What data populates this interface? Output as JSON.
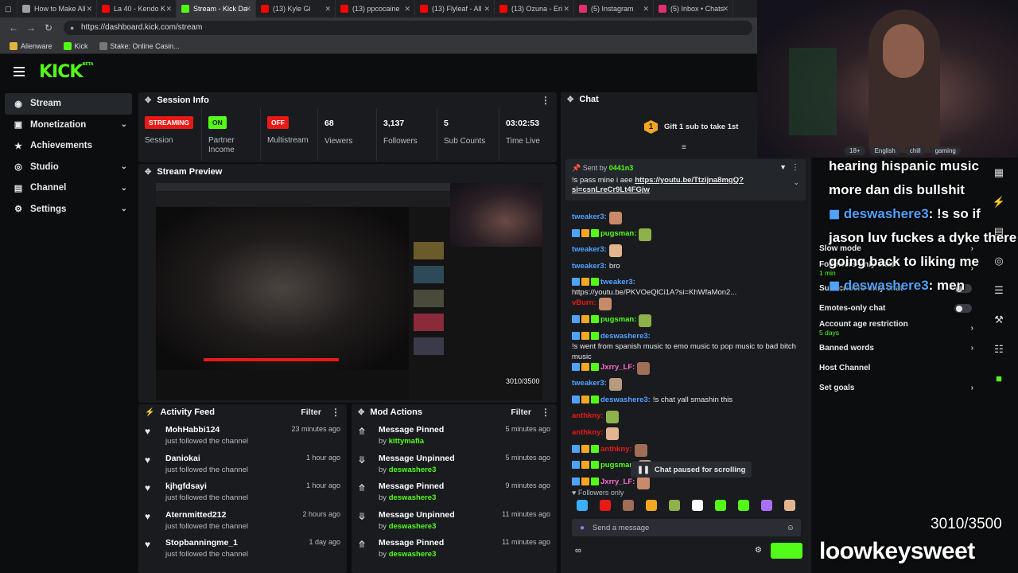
{
  "browser": {
    "tabs": [
      {
        "label": "How to Make All",
        "color": "#9aa0a6"
      },
      {
        "label": "La 40 - Kendo K",
        "color": "#ff0000"
      },
      {
        "label": "Stream - Kick Da",
        "color": "#53fc18",
        "active": true
      },
      {
        "label": "(13) Kyle Gi",
        "color": "#ff0000"
      },
      {
        "label": "(13) ppcocaine",
        "color": "#ff0000"
      },
      {
        "label": "(13) Flyleaf - All",
        "color": "#ff0000"
      },
      {
        "label": "(13) Ozuna - Eri",
        "color": "#ff0000"
      },
      {
        "label": "(5) Instagram",
        "color": "#e1306c"
      },
      {
        "label": "(5) Inbox • Chats",
        "color": "#e1306c"
      }
    ],
    "url": "https://dashboard.kick.com/stream",
    "bookmarks": [
      "Alienware",
      "Kick",
      "Stake: Online Casin..."
    ]
  },
  "header": {
    "logo": "KICK",
    "logo_sup": "BETA"
  },
  "sidebar": {
    "items": [
      {
        "label": "Stream",
        "icon": "broadcast-icon"
      },
      {
        "label": "Monetization",
        "icon": "money-icon"
      },
      {
        "label": "Achievements",
        "icon": "trophy-icon"
      },
      {
        "label": "Studio",
        "icon": "studio-icon"
      },
      {
        "label": "Channel",
        "icon": "channel-icon"
      },
      {
        "label": "Settings",
        "icon": "gear-icon"
      }
    ]
  },
  "session": {
    "title": "Session Info",
    "stats": [
      {
        "badge": "STREAMING",
        "badge_color": "#e91916",
        "label": "Session"
      },
      {
        "badge": "ON",
        "badge_color": "#53fc18",
        "label": "Partner Income"
      },
      {
        "badge": "OFF",
        "badge_color": "#e91916",
        "label": "Multistream"
      },
      {
        "value": "68",
        "label": "Viewers"
      },
      {
        "value": "3,137",
        "label": "Followers"
      },
      {
        "value": "5",
        "label": "Sub Counts"
      },
      {
        "value": "03:02:53",
        "label": "Time Live"
      }
    ]
  },
  "preview": {
    "title": "Stream Preview",
    "counter": "3010/3500"
  },
  "activity": {
    "title": "Activity Feed",
    "filter": "Filter",
    "items": [
      {
        "name": "MohHabbi124",
        "sub": "just followed the channel",
        "time": "23 minutes ago"
      },
      {
        "name": "Daniokai",
        "sub": "just followed the channel",
        "time": "1 hour ago"
      },
      {
        "name": "kjhgfdsayi",
        "sub": "just followed the channel",
        "time": "1 hour ago"
      },
      {
        "name": "Aternmitted212",
        "sub": "just followed the channel",
        "time": "2 hours ago"
      },
      {
        "name": "Stopbanningme_1",
        "sub": "just followed the channel",
        "time": "1 day ago"
      }
    ]
  },
  "modactions": {
    "title": "Mod Actions",
    "filter": "Filter",
    "items": [
      {
        "name": "Message Pinned",
        "by": "by",
        "user": "kittymafia",
        "time": "5 minutes ago",
        "icon": "pin-icon"
      },
      {
        "name": "Message Unpinned",
        "by": "by",
        "user": "deswashere3",
        "time": "5 minutes ago",
        "icon": "unpin-icon"
      },
      {
        "name": "Message Pinned",
        "by": "by",
        "user": "deswashere3",
        "time": "9 minutes ago",
        "icon": "pin-icon"
      },
      {
        "name": "Message Unpinned",
        "by": "by",
        "user": "deswashere3",
        "time": "11 minutes ago",
        "icon": "unpin-icon"
      },
      {
        "name": "Message Pinned",
        "by": "by",
        "user": "deswashere3",
        "time": "11 minutes ago",
        "icon": "pin-icon"
      }
    ]
  },
  "chat": {
    "title": "Chat",
    "gift_count": "1",
    "gift_text": "Gift 1 sub to take 1st",
    "pinned": {
      "sent_by_label": "Sent by",
      "sent_by_user": "0441n3",
      "text": "!s pass mine i aee",
      "link": "https://youtu.be/Ttzijna8mgQ?si=csnLreCr9Lt4FGjw"
    },
    "messages": [
      {
        "user": "tweaker3:",
        "color": "#4fa3ff",
        "text": ""
      },
      {
        "user": "pugsman:",
        "color": "#53fc18",
        "text": ""
      },
      {
        "user": "tweaker3:",
        "color": "#4fa3ff",
        "text": ""
      },
      {
        "user": "tweaker3:",
        "color": "#4fa3ff",
        "text": "bro"
      },
      {
        "user": "tweaker3:",
        "color": "#4fa3ff",
        "text": "https://youtu.be/PKVOeQlCi1A?si=KhWfaMon2..."
      },
      {
        "user": "vBurn:",
        "color": "#e91916",
        "text": ""
      },
      {
        "user": "pugsman:",
        "color": "#53fc18",
        "text": ""
      },
      {
        "user": "deswashere3:",
        "color": "#4fa3ff",
        "text": "!s went from spanish music to emo music to pop music to bad bitch music"
      },
      {
        "user": "Jxrry_LF:",
        "color": "#ff6bcb",
        "text": ""
      },
      {
        "user": "tweaker3:",
        "color": "#4fa3ff",
        "text": ""
      },
      {
        "user": "deswashere3:",
        "color": "#4fa3ff",
        "text": "!s chat yall smashin this"
      },
      {
        "user": "anthkny:",
        "color": "#e91916",
        "text": ""
      },
      {
        "user": "anthkny:",
        "color": "#e91916",
        "text": ""
      },
      {
        "user": "anthkny:",
        "color": "#e91916",
        "text": ""
      },
      {
        "user": "pugsman:",
        "color": "#53fc18",
        "text": ""
      },
      {
        "user": "Jxrry_LF:",
        "color": "#ff6bcb",
        "text": ""
      }
    ],
    "paused": "Chat paused for scrolling",
    "followers_only": "Followers only",
    "placeholder": "Send a message"
  },
  "chat_settings": {
    "items": [
      {
        "label": "Slow mode",
        "type": "arrow"
      },
      {
        "label": "Followers-only chat",
        "sub": "1 min",
        "type": "arrow"
      },
      {
        "label": "Subscribers-only chat",
        "type": "toggle"
      },
      {
        "label": "Emotes-only chat",
        "type": "toggle"
      },
      {
        "label": "Account age restriction",
        "sub": "5 days",
        "type": "arrow"
      },
      {
        "label": "Banned words",
        "type": "arrow"
      },
      {
        "label": "Host Channel",
        "type": "none"
      },
      {
        "label": "Set goals",
        "type": "arrow"
      }
    ]
  },
  "overlay": {
    "tags": [
      "18+",
      "English",
      "chill",
      "gaming"
    ],
    "lines": [
      "hearing hispanic music",
      "more dan dis bullshit"
    ],
    "msg1_user": "deswashere3",
    "msg1_text": ": !s so if jason luv fuckes a dyke there going back to liking me",
    "msg2_user": "deswashere3",
    "msg2_text": ": men",
    "counter": "3010/3500",
    "streamer": "loowkeysweet"
  }
}
